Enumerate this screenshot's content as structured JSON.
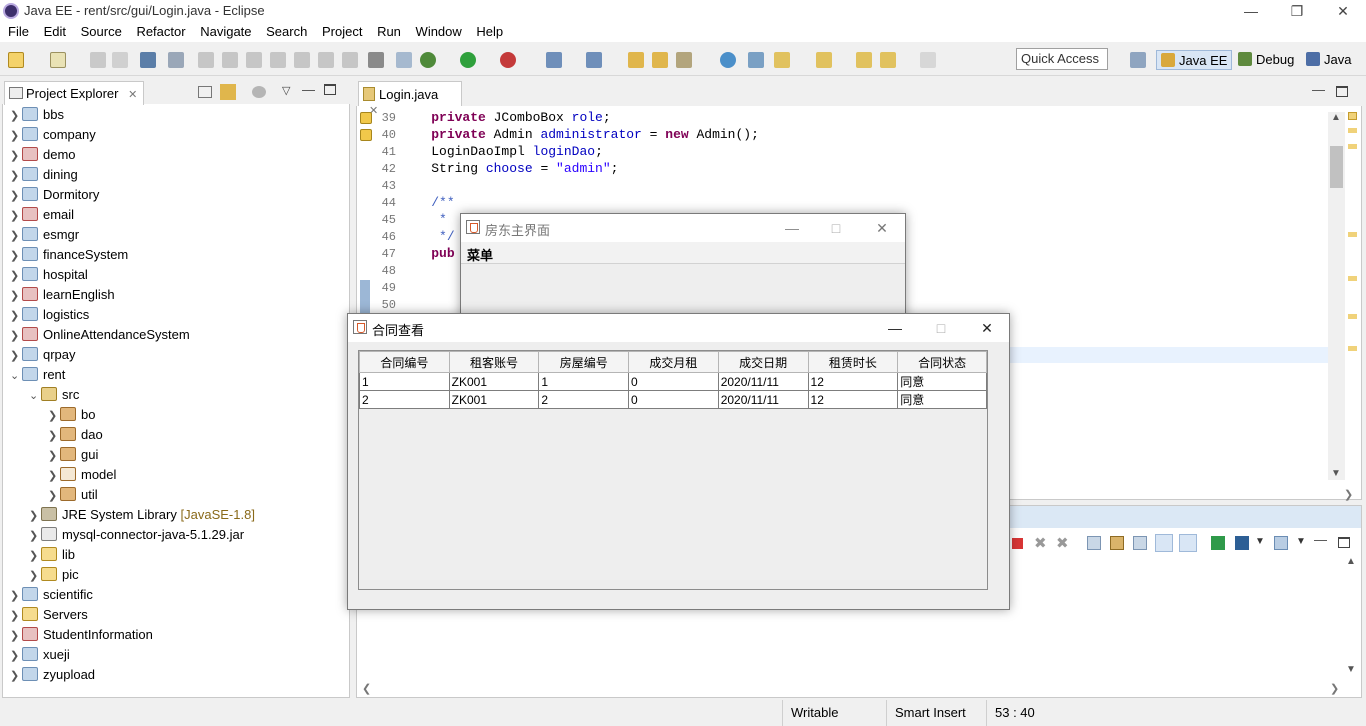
{
  "window": {
    "title": "Java EE - rent/src/gui/Login.java - Eclipse"
  },
  "menu": [
    "File",
    "Edit",
    "Source",
    "Refactor",
    "Navigate",
    "Search",
    "Project",
    "Run",
    "Window",
    "Help"
  ],
  "toolbar": {
    "quick_access": "Quick Access",
    "perspectives": [
      "Java EE",
      "Debug",
      "Java"
    ]
  },
  "project_explorer": {
    "title": "Project Explorer",
    "items": [
      {
        "label": "bbs"
      },
      {
        "label": "company"
      },
      {
        "label": "demo"
      },
      {
        "label": "dining"
      },
      {
        "label": "Dormitory"
      },
      {
        "label": "email"
      },
      {
        "label": "esmgr"
      },
      {
        "label": "financeSystem"
      },
      {
        "label": "hospital"
      },
      {
        "label": "learnEnglish"
      },
      {
        "label": "logistics"
      },
      {
        "label": "OnlineAttendanceSystem"
      },
      {
        "label": "qrpay"
      },
      {
        "label": "rent"
      },
      {
        "label": "src"
      },
      {
        "label": "bo"
      },
      {
        "label": "dao"
      },
      {
        "label": "gui"
      },
      {
        "label": "model"
      },
      {
        "label": "util"
      },
      {
        "label": "JRE System Library",
        "tag": "[JavaSE-1.8]"
      },
      {
        "label": "mysql-connector-java-5.1.29.jar"
      },
      {
        "label": "lib"
      },
      {
        "label": "pic"
      },
      {
        "label": "scientific"
      },
      {
        "label": "Servers"
      },
      {
        "label": "StudentInformation"
      },
      {
        "label": "xueji"
      },
      {
        "label": "zyupload"
      }
    ]
  },
  "editor": {
    "tab": "Login.java",
    "line_numbers": [
      "39",
      "40",
      "41",
      "42",
      "43",
      "44",
      "45",
      "46",
      "47",
      "48",
      "49",
      "50"
    ],
    "lines": {
      "l39": [
        "private",
        " JComboBox ",
        "role",
        ";"
      ],
      "l40": [
        "private",
        " Admin ",
        "administrator",
        " = ",
        "new",
        " Admin();"
      ],
      "l41": [
        "LoginDaoImpl ",
        "loginDao",
        ";"
      ],
      "l42": [
        "String ",
        "choose",
        " = ",
        "\"admin\"",
        ";"
      ],
      "l44": "/**",
      "l45": " *",
      "l46": " */",
      "l47": "pub"
    }
  },
  "landlord_window": {
    "title": "房东主界面",
    "menu": "菜单"
  },
  "contract_window": {
    "title": "合同查看",
    "columns": [
      "合同编号",
      "租客账号",
      "房屋编号",
      "成交月租",
      "成交日期",
      "租赁时长",
      "合同状态"
    ],
    "rows": [
      [
        "1",
        "ZK001",
        "1",
        "0",
        "2020/11/11",
        "12",
        "同意"
      ],
      [
        "2",
        "ZK001",
        "2",
        "0",
        "2020/11/11",
        "12",
        "同意"
      ]
    ]
  },
  "status_bar": {
    "mode": "Writable",
    "insert": "Smart Insert",
    "position": "53 : 40"
  }
}
